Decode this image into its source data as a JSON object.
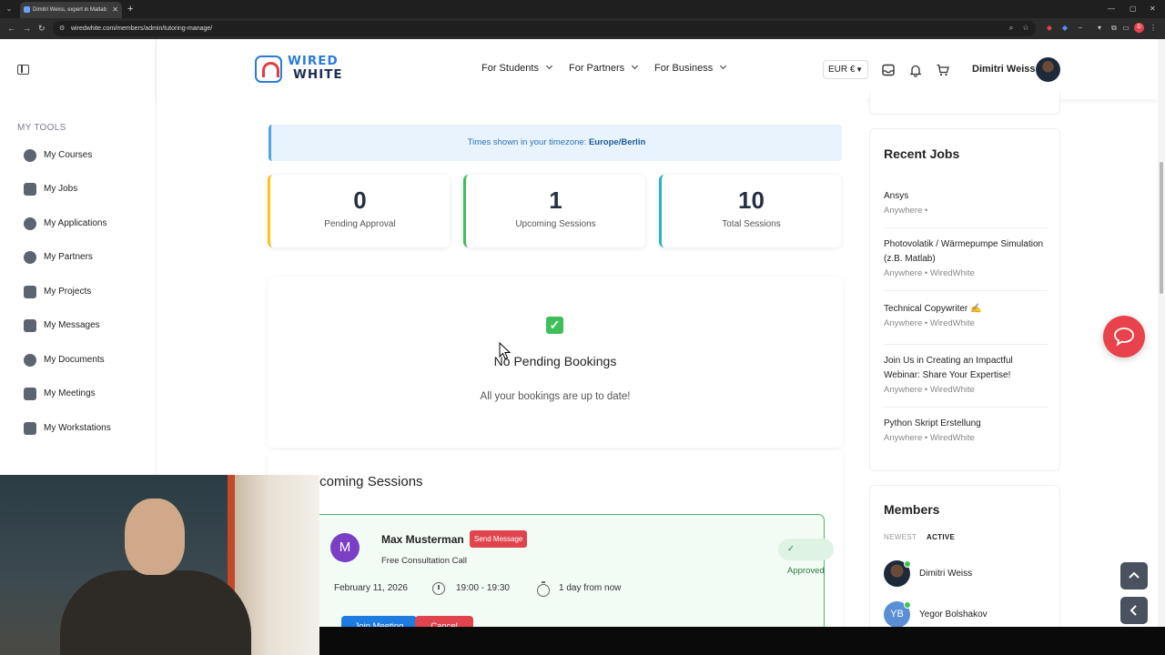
{
  "browser": {
    "tab_title": "Dimitri Weiss, expert in Matlab",
    "url": "wiredwhite.com/members/admin/tutoring-manage/",
    "new_tab": "+",
    "min": "—",
    "max": "▢",
    "close": "✕"
  },
  "header": {
    "logo_line1": "WIRED",
    "logo_line2": "WHITE",
    "nav": [
      "For Students",
      "For Partners",
      "For Business"
    ],
    "currency": "EUR €",
    "user_name": "Dimitri Weiss"
  },
  "sidebar": {
    "section_title": "MY TOOLS",
    "items": [
      "My Courses",
      "My Jobs",
      "My Applications",
      "My Partners",
      "My Projects",
      "My Messages",
      "My Documents",
      "My Meetings",
      "My Workstations"
    ]
  },
  "main": {
    "timezone_prefix": "Times shown in your timezone:",
    "timezone": "Europe/Berlin",
    "stats": [
      {
        "value": "0",
        "label": "Pending Approval",
        "color": "#f5c518"
      },
      {
        "value": "1",
        "label": "Upcoming Sessions",
        "color": "#3fbf5a"
      },
      {
        "value": "10",
        "label": "Total Sessions",
        "color": "#2bb3c0"
      }
    ],
    "pending": {
      "title": "No Pending Bookings",
      "subtitle": "All your bookings are up to date!"
    },
    "upcoming": {
      "title": "Upcoming Sessions",
      "session": {
        "avatar_letter": "M",
        "name": "Max Musterman",
        "send_message": "Send Message",
        "type": "Free Consultation Call",
        "status": "✓ Approved",
        "date": "February 11, 2026",
        "time": "19:00 - 19:30",
        "relative": "1 day from now",
        "join_label": "Join Meeting",
        "cancel_label": "Cancel"
      }
    }
  },
  "right": {
    "jobs_title": "Recent Jobs",
    "jobs": [
      {
        "title": "Ansys",
        "meta": "Anywhere  •"
      },
      {
        "title": "Photovolatik / Wärmepumpe Simulation (z.B. Matlab)",
        "meta": "Anywhere  •  WiredWhite"
      },
      {
        "title": "Technical Copywriter ✍",
        "meta": "Anywhere  •  WiredWhite"
      },
      {
        "title": "Join Us in Creating an Impactful Webinar: Share Your Expertise!",
        "meta": "Anywhere  •  WiredWhite"
      },
      {
        "title": "Python Skript Erstellung",
        "meta": "Anywhere  •  WiredWhite"
      }
    ],
    "members_title": "Members",
    "member_tabs": [
      "NEWEST",
      "ACTIVE"
    ],
    "members": [
      {
        "name": "Dimitri Weiss",
        "initials": ""
      },
      {
        "name": "Yegor Bolshakov",
        "initials": "YB"
      }
    ]
  },
  "colors": {
    "brand_blue": "#2a7bd8",
    "brand_red": "#e53c3c",
    "approved_green": "#3fbf5a",
    "danger": "#e0454e"
  }
}
